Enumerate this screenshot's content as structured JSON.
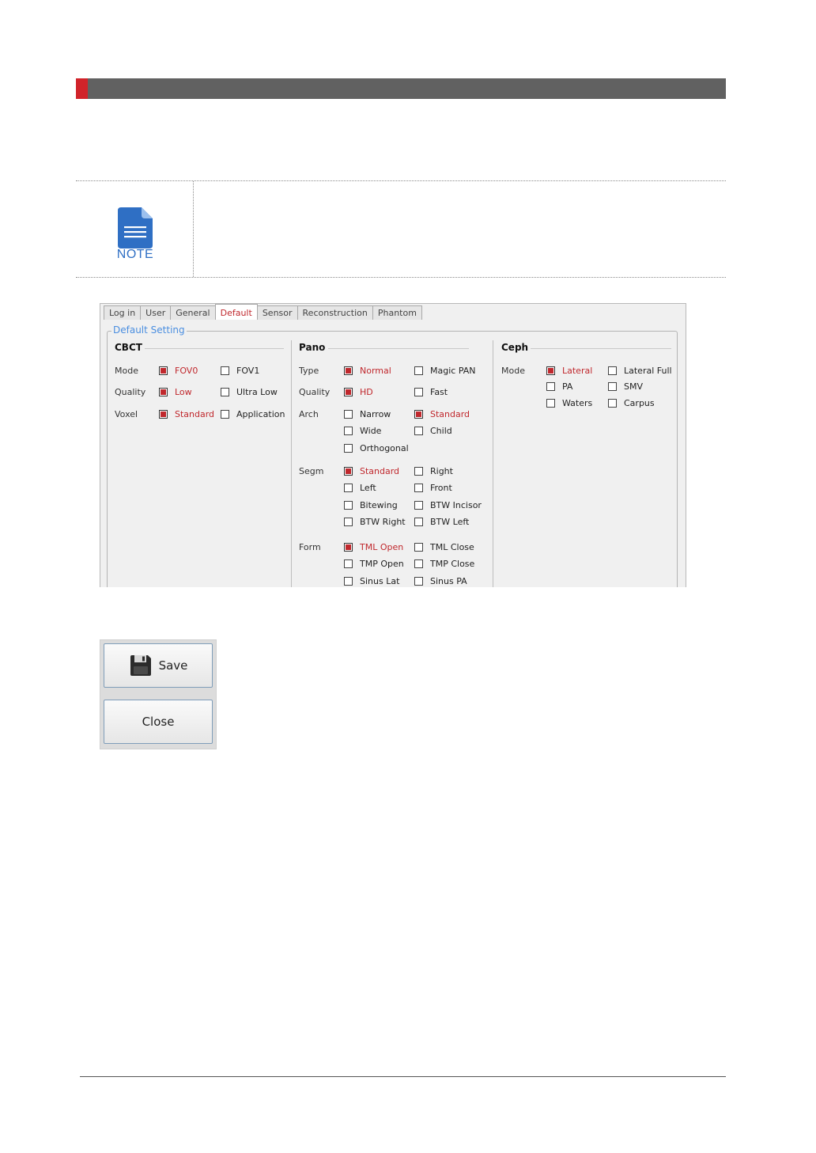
{
  "note": {
    "label": "NOTE"
  },
  "settings": {
    "tabs": [
      "Log in",
      "User",
      "General",
      "Default",
      "Sensor",
      "Reconstruction",
      "Phantom"
    ],
    "active_tab": "Default",
    "group_title": "Default Setting",
    "cbct": {
      "title": "CBCT",
      "rows": [
        {
          "label": "Mode",
          "options": [
            {
              "text": "FOV0",
              "checked": true
            },
            {
              "text": "FOV1",
              "checked": false
            }
          ]
        },
        {
          "label": "Quality",
          "options": [
            {
              "text": "Low",
              "checked": true
            },
            {
              "text": "Ultra Low",
              "checked": false
            }
          ]
        },
        {
          "label": "Voxel",
          "options": [
            {
              "text": "Standard",
              "checked": true
            },
            {
              "text": "Application",
              "checked": false
            }
          ]
        }
      ]
    },
    "pano": {
      "title": "Pano",
      "rows": [
        {
          "label": "Type",
          "options": [
            {
              "text": "Normal",
              "checked": true
            },
            {
              "text": "Magic PAN",
              "checked": false
            }
          ]
        },
        {
          "label": "Quality",
          "options": [
            {
              "text": "HD",
              "checked": true
            },
            {
              "text": "Fast",
              "checked": false
            }
          ]
        },
        {
          "label": "Arch",
          "options": [
            {
              "text": "Narrow",
              "checked": false
            },
            {
              "text": "Standard",
              "checked": true
            },
            {
              "text": "Wide",
              "checked": false
            },
            {
              "text": "Child",
              "checked": false
            },
            {
              "text": "Orthogonal",
              "checked": false
            }
          ]
        },
        {
          "label": "Segm",
          "options": [
            {
              "text": "Standard",
              "checked": true
            },
            {
              "text": "Right",
              "checked": false
            },
            {
              "text": "Left",
              "checked": false
            },
            {
              "text": "Front",
              "checked": false
            },
            {
              "text": "Bitewing",
              "checked": false
            },
            {
              "text": "BTW Incisor",
              "checked": false
            },
            {
              "text": "BTW Right",
              "checked": false
            },
            {
              "text": "BTW Left",
              "checked": false
            }
          ]
        },
        {
          "label": "Form",
          "options": [
            {
              "text": "TML Open",
              "checked": true
            },
            {
              "text": "TML Close",
              "checked": false
            },
            {
              "text": "TMP Open",
              "checked": false
            },
            {
              "text": "TMP Close",
              "checked": false
            },
            {
              "text": "Sinus Lat",
              "checked": false
            },
            {
              "text": "Sinus PA",
              "checked": false
            }
          ]
        }
      ]
    },
    "ceph": {
      "title": "Ceph",
      "rows": [
        {
          "label": "Mode",
          "options": [
            {
              "text": "Lateral",
              "checked": true
            },
            {
              "text": "Lateral Full",
              "checked": false
            },
            {
              "text": "PA",
              "checked": false
            },
            {
              "text": "SMV",
              "checked": false
            },
            {
              "text": "Waters",
              "checked": false
            },
            {
              "text": "Carpus",
              "checked": false
            }
          ]
        }
      ]
    }
  },
  "buttons": {
    "save_label": "Save",
    "close_label": "Close"
  },
  "colors": {
    "accent": "#d1232a",
    "header": "#616161",
    "checked": "#c0282d",
    "legend": "#4a8ee0",
    "note_icon": "#2f6fc4"
  }
}
